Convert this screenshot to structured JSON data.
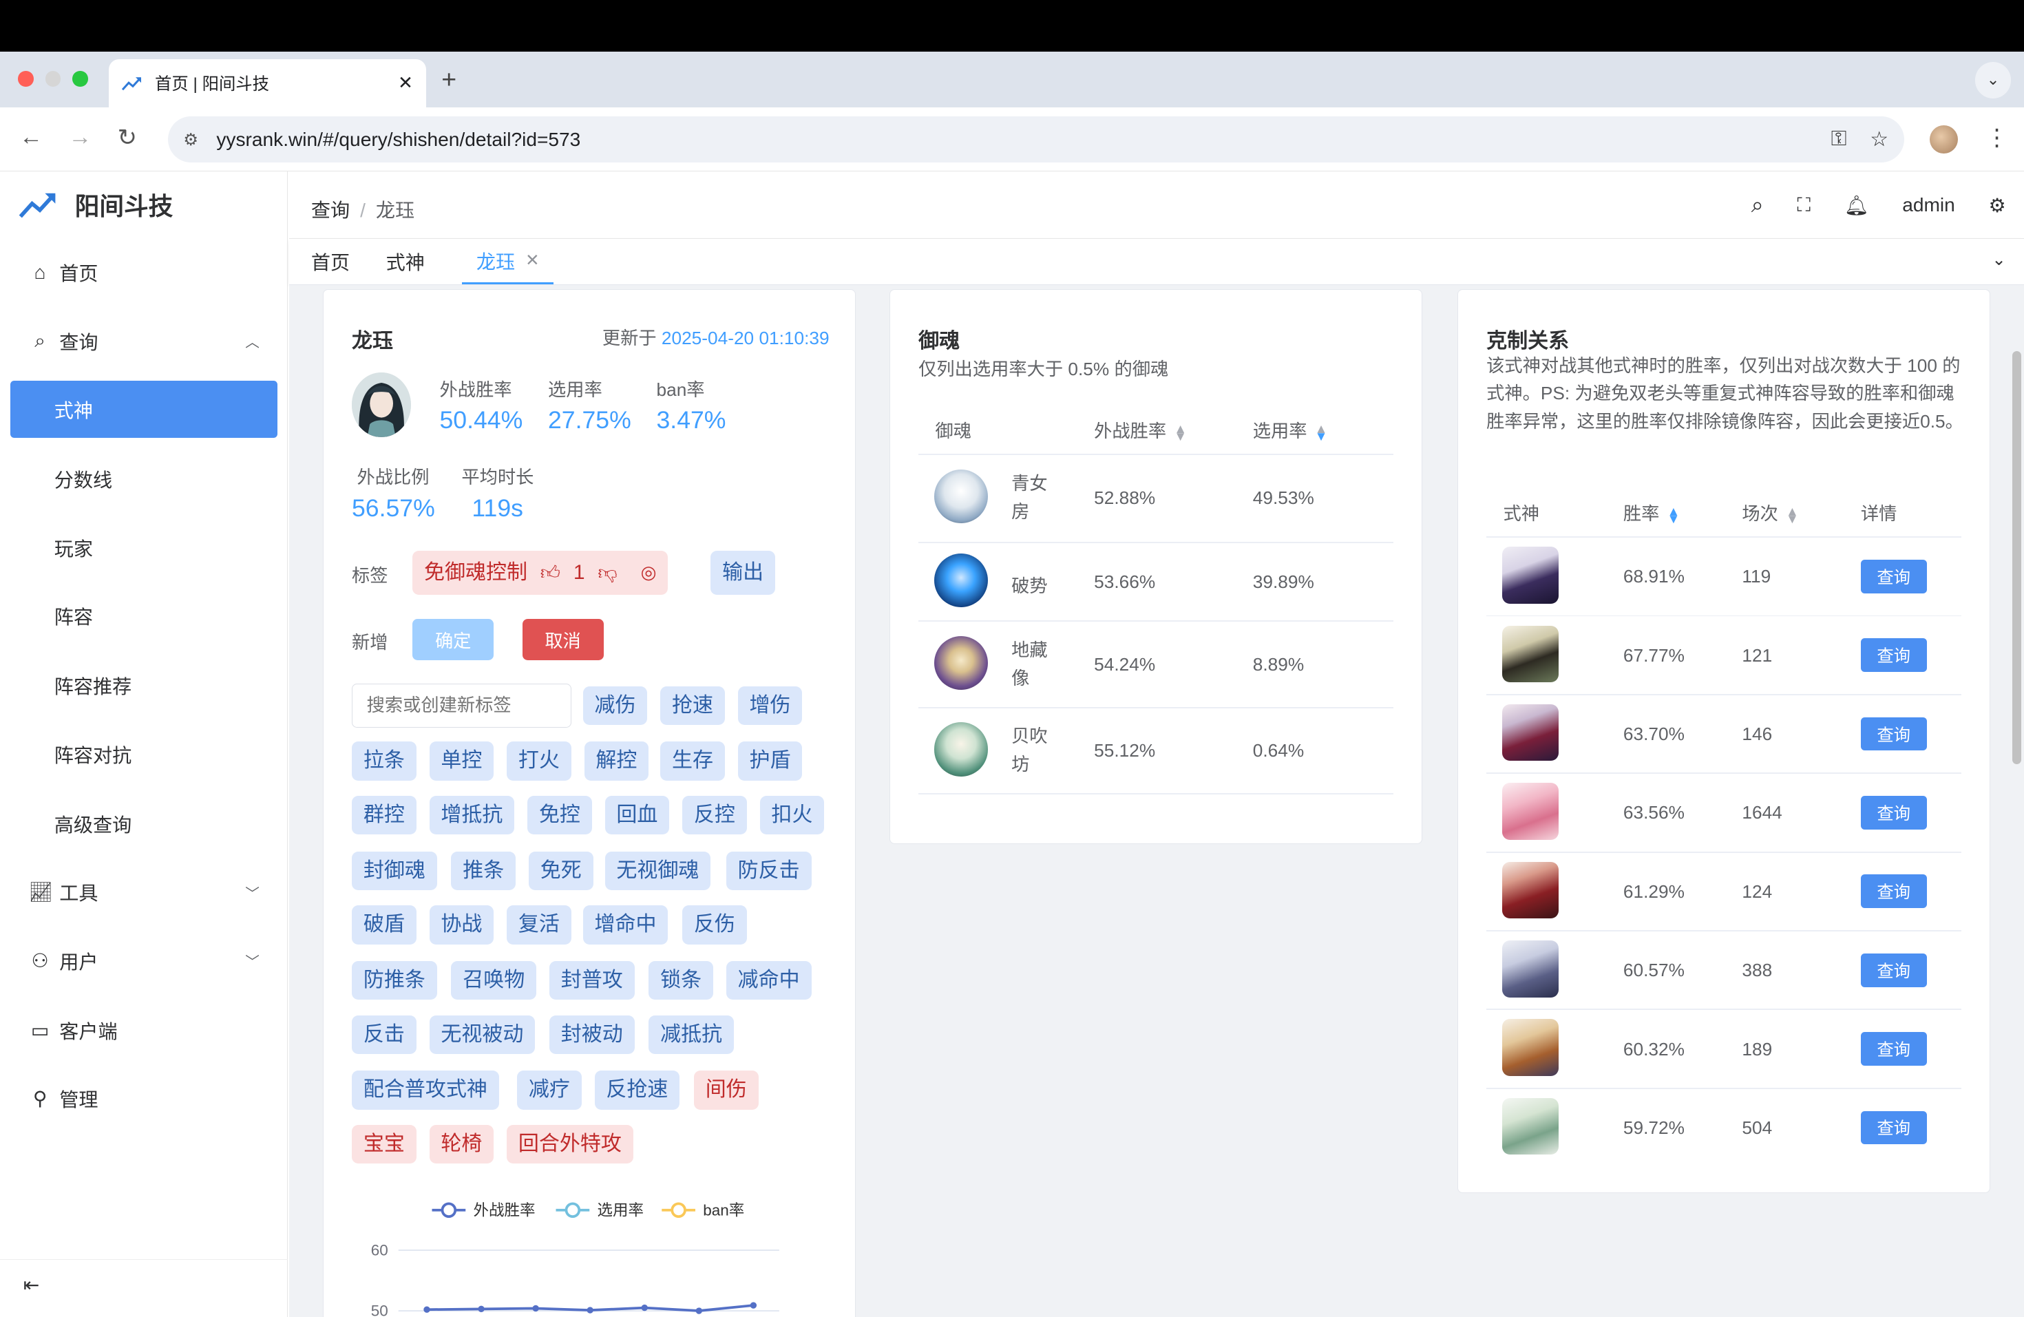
{
  "browser": {
    "tab_title": "首页 | 阳间斗技",
    "url": "yysrank.win/#/query/shishen/detail?id=573"
  },
  "sidebar": {
    "brand": "阳间斗技",
    "items": {
      "home": "首页",
      "query": "查询",
      "tools": "工具",
      "user": "用户",
      "client": "客户端",
      "admin": "管理"
    },
    "query_sub": [
      "式神",
      "分数线",
      "玩家",
      "阵容",
      "阵容推荐",
      "阵容对抗",
      "高级查询"
    ]
  },
  "header": {
    "breadcrumb_root": "查询",
    "breadcrumb_current": "龙珏",
    "user": "admin"
  },
  "tagsview": [
    "首页",
    "式神",
    "龙珏"
  ],
  "shishen": {
    "name": "龙珏",
    "updated_label": "更新于",
    "updated_at": "2025-04-20 01:10:39",
    "stats": [
      {
        "label": "外战胜率",
        "value": "50.44%"
      },
      {
        "label": "选用率",
        "value": "27.75%"
      },
      {
        "label": "ban率",
        "value": "3.47%"
      },
      {
        "label": "外战比例",
        "value": "56.57%"
      },
      {
        "label": "平均时长",
        "value": "119s"
      }
    ],
    "tags_label": "标签",
    "assigned_tags": [
      {
        "text": "免御魂控制",
        "likes": "1",
        "style": "red"
      },
      {
        "text": "输出",
        "style": "blue"
      }
    ],
    "new_label": "新增",
    "confirm": "确定",
    "cancel": "取消",
    "tag_input_placeholder": "搜索或创建新标签",
    "candidate_tags": [
      "减伤",
      "抢速",
      "增伤",
      "拉条",
      "单控",
      "打火",
      "解控",
      "生存",
      "护盾",
      "群控",
      "增抵抗",
      "免控",
      "回血",
      "反控",
      "扣火",
      "封御魂",
      "推条",
      "免死",
      "无视御魂",
      "防反击",
      "破盾",
      "协战",
      "复活",
      "增命中",
      "反伤",
      "防推条",
      "召唤物",
      "封普攻",
      "锁条",
      "减命中",
      "反击",
      "无视被动",
      "封被动",
      "减抵抗",
      "配合普攻式神",
      "减疗",
      "反抢速",
      "间伤",
      "宝宝",
      "轮椅",
      "回合外特攻"
    ],
    "chart": {
      "legend": [
        "外战胜率",
        "选用率",
        "ban率"
      ],
      "y_ticks": [
        "60",
        "50"
      ]
    }
  },
  "chart_data": {
    "type": "line",
    "series": [
      {
        "name": "外战胜率",
        "values": [
          50.2,
          50.3,
          50.4,
          50.1,
          50.5,
          50.0,
          50.9
        ]
      }
    ],
    "ylim": [
      50,
      60
    ],
    "colors": {
      "外战胜率": "#5470c6",
      "选用率": "#73c0de",
      "ban率": "#fac858"
    }
  },
  "yuhun": {
    "title": "御魂",
    "subtitle": "仅列出选用率大于 0.5% 的御魂",
    "columns": [
      "御魂",
      "外战胜率",
      "选用率"
    ],
    "rows": [
      {
        "name_l1": "青女",
        "name_l2": "房",
        "win": "52.88%",
        "pick": "49.53%",
        "avatar": "qingnvfang-icon"
      },
      {
        "name_l1": "破势",
        "name_l2": "",
        "win": "53.66%",
        "pick": "39.89%",
        "avatar": "poshi-icon"
      },
      {
        "name_l1": "地藏",
        "name_l2": "像",
        "win": "54.24%",
        "pick": "8.89%",
        "avatar": "dizangxiang-icon"
      },
      {
        "name_l1": "贝吹",
        "name_l2": "坊",
        "win": "55.12%",
        "pick": "0.64%",
        "avatar": "beichuifang-icon"
      }
    ]
  },
  "counter": {
    "title": "克制关系",
    "description": "该式神对战其他式神时的胜率，仅列出对战次数大于 100 的式神。PS: 为避免双老头等重复式神阵容导致的胜率和御魂胜率异常，这里的胜率仅排除镜像阵容，因此会更接近0.5。",
    "columns": [
      "式神",
      "胜率",
      "场次",
      "详情"
    ],
    "query_label": "查询",
    "rows": [
      {
        "rate": "68.91%",
        "count": "119"
      },
      {
        "rate": "67.77%",
        "count": "121"
      },
      {
        "rate": "63.70%",
        "count": "146"
      },
      {
        "rate": "63.56%",
        "count": "1644"
      },
      {
        "rate": "61.29%",
        "count": "124"
      },
      {
        "rate": "60.57%",
        "count": "388"
      },
      {
        "rate": "60.32%",
        "count": "189"
      },
      {
        "rate": "59.72%",
        "count": "504"
      }
    ]
  }
}
